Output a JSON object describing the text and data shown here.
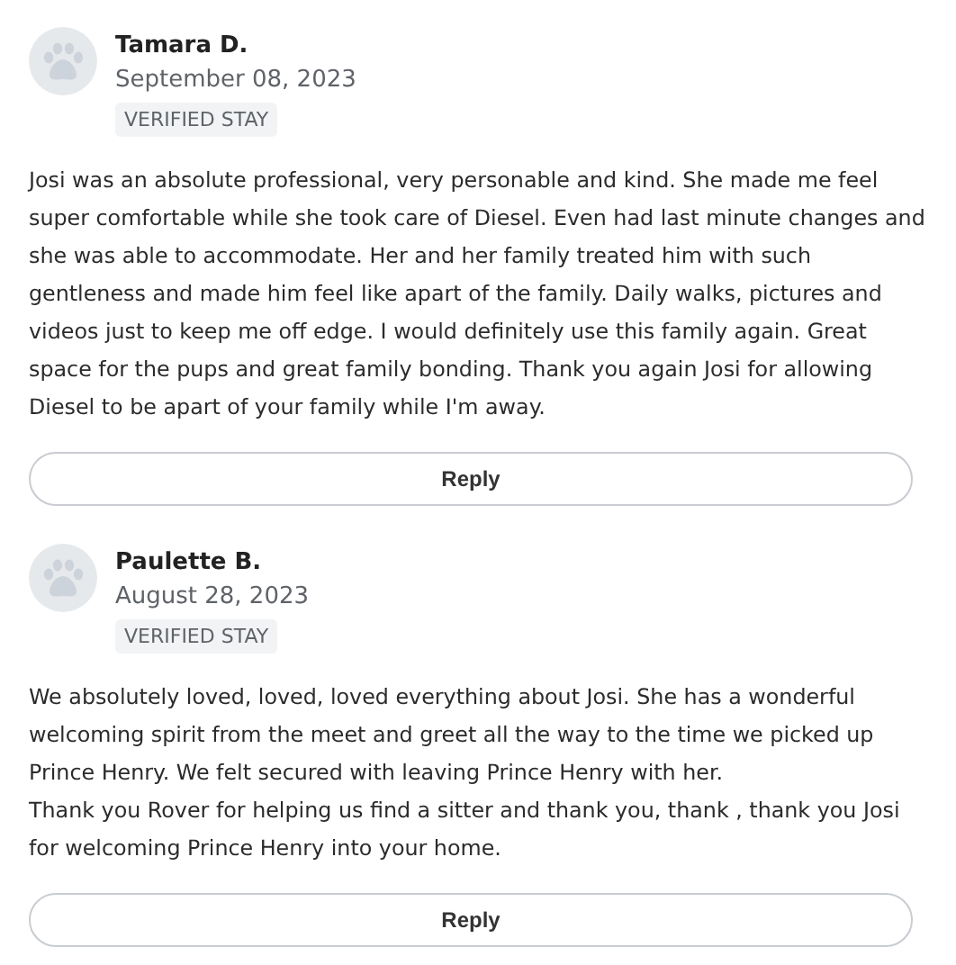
{
  "reviews": [
    {
      "name": "Tamara D.",
      "date": "September 08, 2023",
      "badge": "VERIFIED STAY",
      "paragraphs": [
        "Josi was an absolute professional, very personable and kind. She made me feel super comfortable while she took care of Diesel. Even had last minute changes and she was able to accommodate. Her and her family treated him with such gentleness and made him feel like apart of the family. Daily walks, pictures and videos just to keep me off edge. I would definitely use this family again. Great space for the pups and great family bonding. Thank you again Josi for allowing Diesel to be apart of your family while I'm away."
      ],
      "reply_button": "Reply"
    },
    {
      "name": "Paulette B.",
      "date": "August 28, 2023",
      "badge": "VERIFIED STAY",
      "paragraphs": [
        "We absolutely loved, loved, loved everything about Josi. She has a wonderful welcoming spirit from the meet and greet all the way to the time we picked up Prince Henry. We felt secured with leaving Prince Henry with her.",
        "Thank you Rover for helping us find a sitter and thank you, thank , thank you Josi for welcoming Prince Henry into your home."
      ],
      "reply_button": "Reply"
    }
  ]
}
